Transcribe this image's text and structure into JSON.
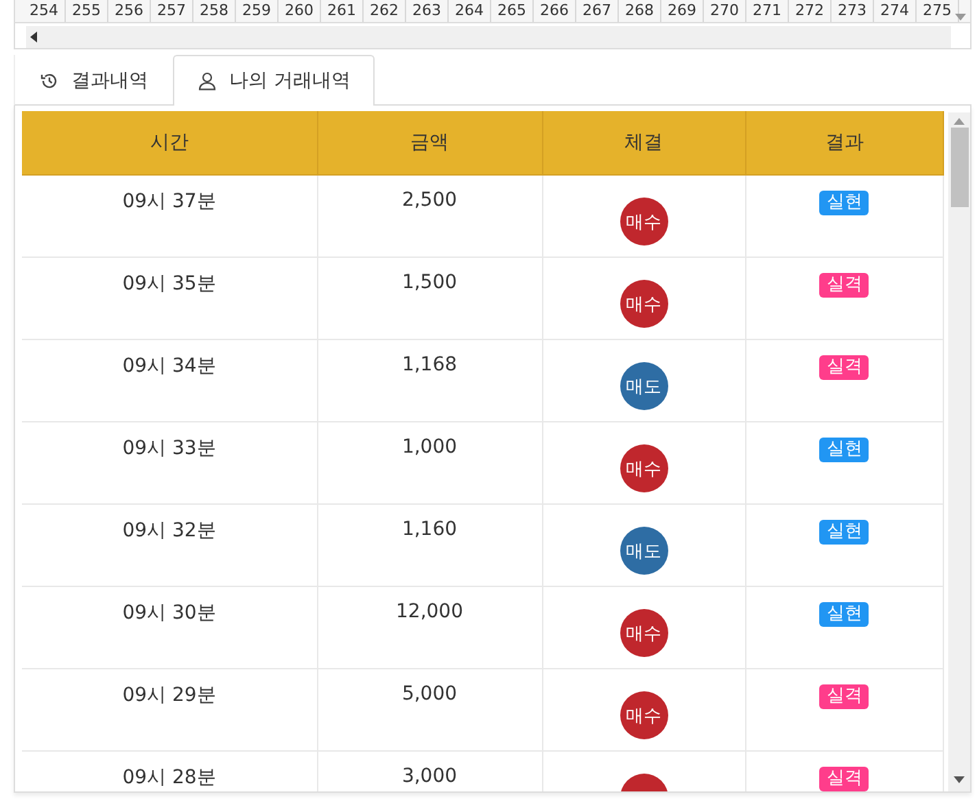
{
  "top_strip": {
    "numbers": [
      "254",
      "255",
      "256",
      "257",
      "258",
      "259",
      "260",
      "261",
      "262",
      "263",
      "264",
      "265",
      "266",
      "267",
      "268",
      "269",
      "270",
      "271",
      "272",
      "273",
      "274",
      "275"
    ]
  },
  "tabs": [
    {
      "label": "결과내역",
      "selected": false
    },
    {
      "label": "나의 거래내역",
      "selected": true
    }
  ],
  "table": {
    "columns": [
      "시간",
      "금액",
      "체결",
      "결과"
    ],
    "rows": [
      {
        "time": "09시 37분",
        "amount": "2,500",
        "trade": {
          "label": "매수",
          "color": "#c0272d"
        },
        "result": {
          "label": "실현",
          "color": "#2196f3"
        }
      },
      {
        "time": "09시 35분",
        "amount": "1,500",
        "trade": {
          "label": "매수",
          "color": "#c0272d"
        },
        "result": {
          "label": "실격",
          "color": "#ff3d8b"
        }
      },
      {
        "time": "09시 34분",
        "amount": "1,168",
        "trade": {
          "label": "매도",
          "color": "#2e6da4"
        },
        "result": {
          "label": "실격",
          "color": "#ff3d8b"
        }
      },
      {
        "time": "09시 33분",
        "amount": "1,000",
        "trade": {
          "label": "매수",
          "color": "#c0272d"
        },
        "result": {
          "label": "실현",
          "color": "#2196f3"
        }
      },
      {
        "time": "09시 32분",
        "amount": "1,160",
        "trade": {
          "label": "매도",
          "color": "#2e6da4"
        },
        "result": {
          "label": "실현",
          "color": "#2196f3"
        }
      },
      {
        "time": "09시 30분",
        "amount": "12,000",
        "trade": {
          "label": "매수",
          "color": "#c0272d"
        },
        "result": {
          "label": "실현",
          "color": "#2196f3"
        }
      },
      {
        "time": "09시 29분",
        "amount": "5,000",
        "trade": {
          "label": "매수",
          "color": "#c0272d"
        },
        "result": {
          "label": "실격",
          "color": "#ff3d8b"
        }
      },
      {
        "time": "09시 28분",
        "amount": "3,000",
        "trade": {
          "color": "#c0272d"
        },
        "result": {
          "label": "실격",
          "color": "#ff3d8b"
        }
      }
    ]
  }
}
